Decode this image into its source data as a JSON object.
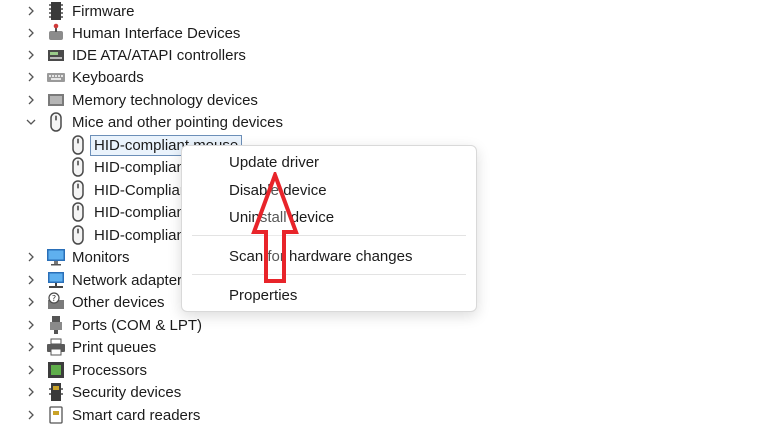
{
  "tree": {
    "items": [
      {
        "label": "Firmware",
        "icon": "firmware-icon",
        "chev": "right"
      },
      {
        "label": "Human Interface Devices",
        "icon": "hid-icon",
        "chev": "right"
      },
      {
        "label": "IDE ATA/ATAPI controllers",
        "icon": "ide-controller-icon",
        "chev": "right"
      },
      {
        "label": "Keyboards",
        "icon": "keyboard-icon",
        "chev": "right"
      },
      {
        "label": "Memory technology devices",
        "icon": "memory-icon",
        "chev": "right"
      },
      {
        "label": "Mice and other pointing devices",
        "icon": "mouse-icon",
        "chev": "down"
      }
    ],
    "children": [
      {
        "label": "HID-compliant mouse",
        "icon": "mouse-icon"
      },
      {
        "label": "HID-complian",
        "icon": "mouse-icon"
      },
      {
        "label": "HID-Complian",
        "icon": "mouse-icon"
      },
      {
        "label": "HID-complian",
        "icon": "mouse-icon"
      },
      {
        "label": "HID-complian",
        "icon": "mouse-icon"
      }
    ],
    "items_after": [
      {
        "label": "Monitors",
        "icon": "monitor-icon",
        "chev": "right"
      },
      {
        "label": "Network adapters",
        "icon": "network-adapter-icon",
        "chev": "right"
      },
      {
        "label": "Other devices",
        "icon": "unknown-device-icon",
        "chev": "right"
      },
      {
        "label": "Ports (COM & LPT)",
        "icon": "port-icon",
        "chev": "right"
      },
      {
        "label": "Print queues",
        "icon": "printer-icon",
        "chev": "right"
      },
      {
        "label": "Processors",
        "icon": "processor-icon",
        "chev": "right"
      },
      {
        "label": "Security devices",
        "icon": "security-device-icon",
        "chev": "right"
      },
      {
        "label": "Smart card readers",
        "icon": "smart-card-reader-icon",
        "chev": "right"
      }
    ]
  },
  "context_menu": {
    "update_driver": "Update driver",
    "disable_device": "Disable device",
    "uninstall_device": "Uninstall device",
    "scan_changes": "Scan for hardware changes",
    "properties": "Properties"
  },
  "colors": {
    "annotation_arrow": "#e8242a",
    "selection_outline": "#6c8fb8"
  }
}
